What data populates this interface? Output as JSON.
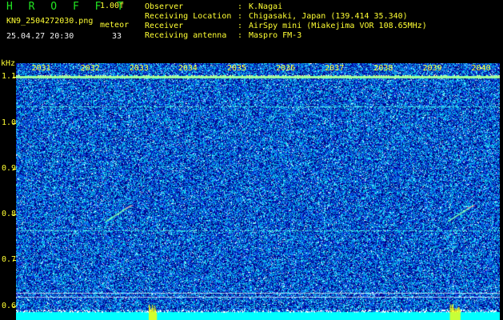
{
  "header": {
    "brand": "H R O F F T",
    "version": "1.00f",
    "filename": "KN9_2504272030.png",
    "meteor_label": "meteor",
    "datetime": "25.04.27 20:30",
    "count": "33"
  },
  "info": [
    {
      "label": "Observer",
      "value": "K.Nagai"
    },
    {
      "label": "Receiving Location",
      "value": "Chigasaki, Japan (139.414 35.340)"
    },
    {
      "label": "Receiver",
      "value": "AirSpy mini (Miakejima VOR 108.65MHz)"
    },
    {
      "label": "Receiving antenna",
      "value": "Maspro FM-3"
    }
  ],
  "colors": {
    "background": "#000000",
    "plot_background": "#00008c",
    "title_green": "#22e622",
    "label_yellow": "#ffff33",
    "noise_cyan": "#00ffff",
    "echo_yellow": "#ffff00"
  },
  "chart_data": {
    "type": "heatmap",
    "title": "",
    "xlabel": "",
    "ylabel": "kHz",
    "x_ticks": [
      "2031",
      "2032",
      "2033",
      "2034",
      "2035",
      "2036",
      "2037",
      "2038",
      "2039",
      "2040"
    ],
    "y_ticks": [
      "1.1",
      "1.0",
      "0.9",
      "0.8",
      "0.7",
      "0.6"
    ],
    "ylim": [
      0.57,
      1.13
    ],
    "xlim": [
      2030.5,
      2040.4
    ],
    "carrier_lines_khz": [
      1.1,
      1.035,
      0.765,
      0.63,
      0.62
    ],
    "meteor_echoes": [
      {
        "time": "2032.7",
        "f_start": 0.79,
        "f_end": 0.82
      },
      {
        "time": "2039.7",
        "f_start": 0.79,
        "f_end": 0.82
      }
    ],
    "bottom_bursts": [
      {
        "time_start": 2033.22,
        "time_end": 2033.38
      },
      {
        "time_start": 2039.38,
        "time_end": 2039.58
      }
    ]
  }
}
